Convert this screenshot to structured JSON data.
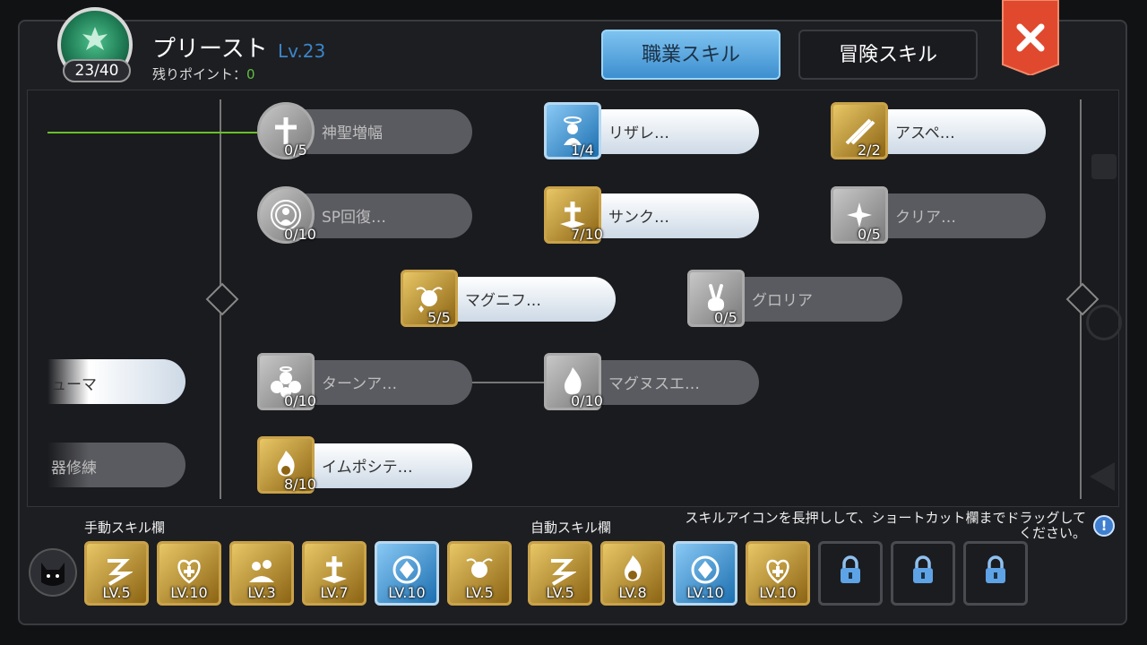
{
  "header": {
    "job_name": "プリースト",
    "job_level": "Lv.23",
    "job_points": "23/40",
    "remaining_label": "残りポイント：",
    "remaining_points": "0"
  },
  "tabs": [
    {
      "label": "職業スキル",
      "active": true
    },
    {
      "label": "冒険スキル",
      "active": false
    }
  ],
  "close_icon": "close-x-icon",
  "skills": [
    {
      "name": "神聖増幅",
      "level": "0/5",
      "style": "dark",
      "icon": "holy-cross-icon"
    },
    {
      "name": "リザレ…",
      "level": "1/4",
      "style": "light",
      "icon": "angel-halo-icon"
    },
    {
      "name": "アスペ…",
      "level": "2/2",
      "style": "light",
      "icon": "swords-icon"
    },
    {
      "name": "SP回復…",
      "level": "0/10",
      "style": "dark",
      "icon": "sp-recovery-icon"
    },
    {
      "name": "サンク…",
      "level": "7/10",
      "style": "light",
      "icon": "sanctuary-icon"
    },
    {
      "name": "クリア…",
      "level": "0/5",
      "style": "dark",
      "icon": "sparkle-icon"
    },
    {
      "name": "マグニフ…",
      "level": "5/5",
      "style": "light",
      "icon": "magnificat-icon"
    },
    {
      "name": "グロリア",
      "level": "0/5",
      "style": "dark",
      "icon": "victory-hand-icon"
    },
    {
      "name": "ターンア…",
      "level": "0/10",
      "style": "dark",
      "icon": "turn-undead-icon"
    },
    {
      "name": "マグヌスエ…",
      "level": "0/10",
      "style": "dark",
      "icon": "magnus-flame-icon"
    },
    {
      "name": "イムポシテ…",
      "level": "8/10",
      "style": "light",
      "icon": "impositio-icon"
    },
    {
      "name": "ューマ",
      "level": "",
      "style": "light",
      "icon": ""
    },
    {
      "name": "器修練",
      "level": "",
      "style": "dark",
      "icon": ""
    }
  ],
  "manual_bar": {
    "label": "手動スキル欄",
    "slots": [
      {
        "level": "LV.5",
        "icon": "heal-icon",
        "color": "gold"
      },
      {
        "level": "LV.10",
        "icon": "heart-cross-icon",
        "color": "gold"
      },
      {
        "level": "LV.3",
        "icon": "blessing-icon",
        "color": "gold"
      },
      {
        "level": "LV.7",
        "icon": "sanctuary-icon",
        "color": "gold"
      },
      {
        "level": "LV.10",
        "icon": "crystal-icon",
        "color": "blue"
      },
      {
        "level": "LV.5",
        "icon": "magnificat-icon",
        "color": "gold"
      }
    ]
  },
  "auto_bar": {
    "label": "自動スキル欄",
    "slots": [
      {
        "level": "LV.5",
        "icon": "heal-icon",
        "color": "gold"
      },
      {
        "level": "LV.8",
        "icon": "impositio-icon",
        "color": "gold"
      },
      {
        "level": "LV.10",
        "icon": "crystal-icon",
        "color": "blue"
      },
      {
        "level": "LV.10",
        "icon": "heart-cross-icon",
        "color": "gold"
      },
      {
        "level": "",
        "icon": "lock-icon",
        "color": "locked"
      },
      {
        "level": "",
        "icon": "lock-icon",
        "color": "locked"
      },
      {
        "level": "",
        "icon": "lock-icon",
        "color": "locked"
      }
    ]
  },
  "hint": "スキルアイコンを長押しして、ショートカット欄までドラッグしてください。",
  "info_label": "!",
  "colors": {
    "accent_blue": "#3d8fcf",
    "gold": "#c9a24a",
    "close_red": "#e0492e",
    "points_green": "#5fbf3f"
  }
}
